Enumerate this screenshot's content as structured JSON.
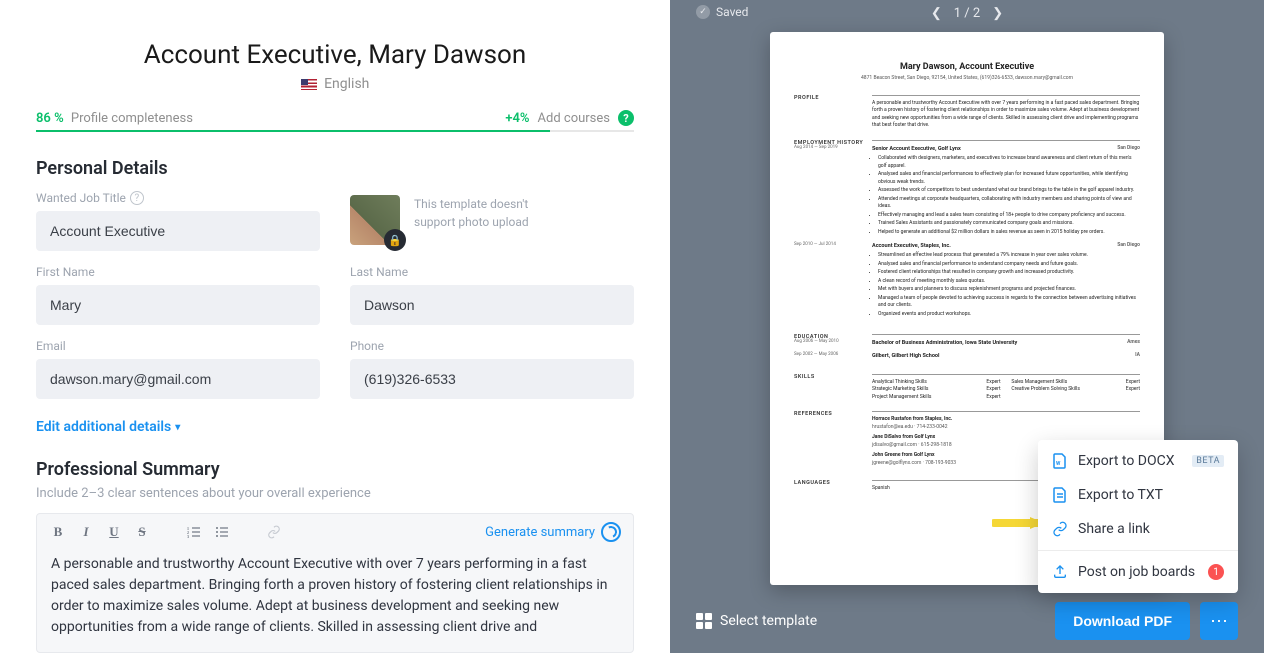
{
  "header": {
    "title": "Account Executive, Mary Dawson",
    "language": "English"
  },
  "progress": {
    "percent_label": "86 %",
    "percent_value": 86,
    "label": "Profile completeness",
    "tip_plus": "+4%",
    "tip_label": "Add courses",
    "help": "?"
  },
  "sections": {
    "personal": {
      "title": "Personal Details",
      "job_title_label": "Wanted Job Title",
      "job_title": "Account Executive",
      "photo_note": "This template doesn't support photo upload",
      "first_name_label": "First Name",
      "first_name": "Mary",
      "last_name_label": "Last Name",
      "last_name": "Dawson",
      "email_label": "Email",
      "email": "dawson.mary@gmail.com",
      "phone_label": "Phone",
      "phone": "(619)326-6533",
      "edit_link": "Edit additional details"
    },
    "summary": {
      "title": "Professional Summary",
      "hint": "Include 2–3 clear sentences about your overall experience",
      "generate": "Generate summary",
      "body": "A personable and trustworthy Account Executive with over 7 years performing in a fast paced sales department. Bringing forth a proven history of fostering client relationships in order to maximize sales volume. Adept at business development and seeking new opportunities from a wide range of clients. Skilled in assessing client drive and"
    }
  },
  "preview": {
    "saved": "Saved",
    "pager": "1 / 2",
    "cv": {
      "name": "Mary Dawson, Account Executive",
      "contact": "4871 Beacon Street, San Diego, 92154, United States, (619)326-6533, dawson.mary@gmail.com",
      "profile_label": "PROFILE",
      "profile_body": "A personable and trustworthy Account Executive with over 7 years performing in a fast paced sales department. Bringing forth a proven history of fostering client relationships in order to maximize sales volume. Adept at business development and seeking new opportunities from a wide range of clients. Skilled in assessing client drive and implementing programs that best foster that drive.",
      "emp_label": "EMPLOYMENT HISTORY",
      "emp": [
        {
          "dates": "Aug 2014 — Sep 2019",
          "title": "Senior Account Executive, Golf Lynx",
          "loc": "San Diego",
          "bullets": [
            "Collaborated with designers, marketers, and executives to increase brand awareness and client return of this men's golf apparel.",
            "Analysed sales and financial performances to effectively plan for increased future opportunities, while identifying obvious weak trends.",
            "Assessed the work of competitors to best understand what our brand brings to the table in the golf apparel industry.",
            "Attended meetings at corporate headquarters, collaborating with industry members and sharing points of view and ideas.",
            "Effectively managing and lead a sales team consisting of 18+ people to drive company proficiency and success.",
            "Trained Sales Assistants and passionately communicated company goals and missions.",
            "Helped to generate an additional $2 million dollars in sales revenue as seen in 2015 holiday pre orders."
          ]
        },
        {
          "dates": "Sep 2010 — Jul 2014",
          "title": "Account Executive, Staples, Inc.",
          "loc": "San Diego",
          "bullets": [
            "Streamlined an effective lead process that generated a 79% increase in year over sales volume.",
            "Analysed sales and financial performance to understand company needs and future goals.",
            "Fostered client relationships that resulted in company growth and increased productivity.",
            "A clean record of meeting monthly sales quotas.",
            "Met with buyers and planners to discuss replenishment programs and projected finances.",
            "Managed a team of people devoted to achieving success in regards to the connection between advertising initiatives and our clients.",
            "Organized events and product workshops."
          ]
        }
      ],
      "edu_label": "EDUCATION",
      "edu": [
        {
          "dates": "Aug 2006 — May 2010",
          "title": "Bachelor of Business Administration, Iowa State University",
          "loc": "Ames"
        },
        {
          "dates": "Sep 2002 — May 2006",
          "title": "Gilbert, Gilbert High School",
          "loc": "IA"
        }
      ],
      "skills_label": "SKILLS",
      "skills": [
        {
          "name": "Analytical Thinking Skills",
          "lvl": "Expert"
        },
        {
          "name": "Sales Management Skills",
          "lvl": "Expert"
        },
        {
          "name": "Strategic Marketing Skills",
          "lvl": "Expert"
        },
        {
          "name": "Creative Problem Solving Skills",
          "lvl": "Expert"
        },
        {
          "name": "Project Management Skills",
          "lvl": "Expert"
        }
      ],
      "ref_label": "REFERENCES",
      "refs": [
        {
          "name": "Horrace Rustafon from Staples, Inc.",
          "info": "hrustafon@ea.edu · 714-233-0042"
        },
        {
          "name": "Jane DiSalvo from Golf Lynx",
          "info": "jdisalvo@gmail.com · 615-298-1818"
        },
        {
          "name": "John Greene from Golf Lynx",
          "info": "jgreene@golflynx.com · 708-193-9033"
        }
      ],
      "lang_label": "LANGUAGES",
      "langs": [
        {
          "name": "Spanish",
          "lvl": ""
        }
      ]
    },
    "select_template": "Select template",
    "download": "Download PDF",
    "menu": {
      "docx": "Export to DOCX",
      "docx_badge": "BETA",
      "txt": "Export to TXT",
      "share": "Share a link",
      "post": "Post on job boards",
      "post_badge": "1"
    }
  }
}
